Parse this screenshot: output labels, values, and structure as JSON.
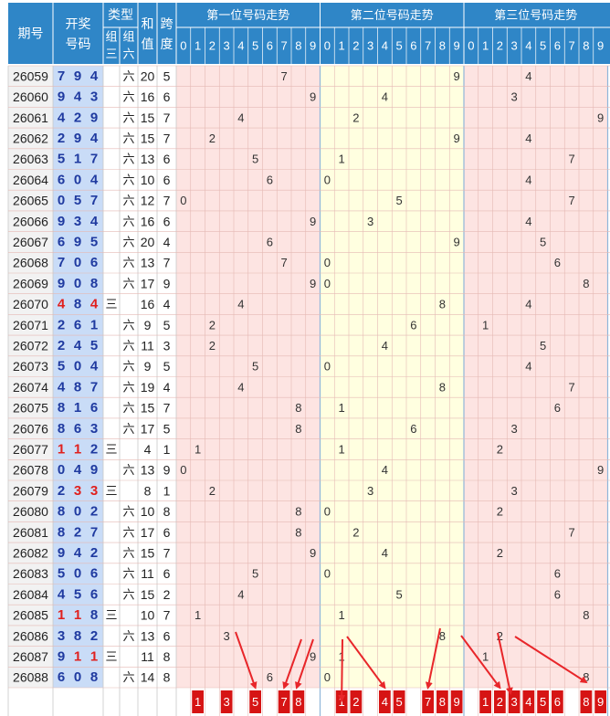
{
  "header": {
    "period_label": "期号",
    "lottery_label_line1": "开奖",
    "lottery_label_line2": "号码",
    "type_label": "类型",
    "zu3_label_line1": "组",
    "zu3_label_line2": "三",
    "zu6_label_line1": "组",
    "zu6_label_line2": "六",
    "sum_label_line1": "和",
    "sum_label_line2": "值",
    "span_label_line1": "跨",
    "span_label_line2": "度",
    "pos1_title": "第一位号码走势",
    "pos2_title": "第二位号码走势",
    "pos3_title": "第三位号码走势",
    "digits": [
      "0",
      "1",
      "2",
      "3",
      "4",
      "5",
      "6",
      "7",
      "8",
      "9"
    ]
  },
  "markers": {
    "zu3": "三",
    "zu6": "六"
  },
  "colors": {
    "header_blue": "#2f86c7",
    "period_bg": "#f2f2f2",
    "number_col_bg": "#c9dcf7",
    "number_blue": "#1f3aa0",
    "number_red": "#e0201e",
    "pos1_bg": "#fde4e2",
    "pos2_bg": "#ffffe0",
    "pos3_bg": "#fde4e2",
    "grid_line": "#e5b9b4",
    "prediction_box": "#d61414",
    "arrow": "#e8262a"
  },
  "chart_data": {
    "type": "table",
    "columns": [
      "期号",
      "开奖号码",
      "组三",
      "组六",
      "和值",
      "跨度",
      "第一位",
      "第二位",
      "第三位"
    ],
    "rows": [
      {
        "period": "26059",
        "digits": [
          7,
          9,
          4
        ],
        "type": "六",
        "sum": 20,
        "span": 5
      },
      {
        "period": "26060",
        "digits": [
          9,
          4,
          3
        ],
        "type": "六",
        "sum": 16,
        "span": 6
      },
      {
        "period": "26061",
        "digits": [
          4,
          2,
          9
        ],
        "type": "六",
        "sum": 15,
        "span": 7
      },
      {
        "period": "26062",
        "digits": [
          2,
          9,
          4
        ],
        "type": "六",
        "sum": 15,
        "span": 7
      },
      {
        "period": "26063",
        "digits": [
          5,
          1,
          7
        ],
        "type": "六",
        "sum": 13,
        "span": 6
      },
      {
        "period": "26064",
        "digits": [
          6,
          0,
          4
        ],
        "type": "六",
        "sum": 10,
        "span": 6
      },
      {
        "period": "26065",
        "digits": [
          0,
          5,
          7
        ],
        "type": "六",
        "sum": 12,
        "span": 7
      },
      {
        "period": "26066",
        "digits": [
          9,
          3,
          4
        ],
        "type": "六",
        "sum": 16,
        "span": 6
      },
      {
        "period": "26067",
        "digits": [
          6,
          9,
          5
        ],
        "type": "六",
        "sum": 20,
        "span": 4
      },
      {
        "period": "26068",
        "digits": [
          7,
          0,
          6
        ],
        "type": "六",
        "sum": 13,
        "span": 7
      },
      {
        "period": "26069",
        "digits": [
          9,
          0,
          8
        ],
        "type": "六",
        "sum": 17,
        "span": 9
      },
      {
        "period": "26070",
        "digits": [
          4,
          8,
          4
        ],
        "type": "三",
        "sum": 16,
        "span": 4
      },
      {
        "period": "26071",
        "digits": [
          2,
          6,
          1
        ],
        "type": "六",
        "sum": 9,
        "span": 5
      },
      {
        "period": "26072",
        "digits": [
          2,
          4,
          5
        ],
        "type": "六",
        "sum": 11,
        "span": 3
      },
      {
        "period": "26073",
        "digits": [
          5,
          0,
          4
        ],
        "type": "六",
        "sum": 9,
        "span": 5
      },
      {
        "period": "26074",
        "digits": [
          4,
          8,
          7
        ],
        "type": "六",
        "sum": 19,
        "span": 4
      },
      {
        "period": "26075",
        "digits": [
          8,
          1,
          6
        ],
        "type": "六",
        "sum": 15,
        "span": 7
      },
      {
        "period": "26076",
        "digits": [
          8,
          6,
          3
        ],
        "type": "六",
        "sum": 17,
        "span": 5
      },
      {
        "period": "26077",
        "digits": [
          1,
          1,
          2
        ],
        "type": "三",
        "sum": 4,
        "span": 1
      },
      {
        "period": "26078",
        "digits": [
          0,
          4,
          9
        ],
        "type": "六",
        "sum": 13,
        "span": 9
      },
      {
        "period": "26079",
        "digits": [
          2,
          3,
          3
        ],
        "type": "三",
        "sum": 8,
        "span": 1
      },
      {
        "period": "26080",
        "digits": [
          8,
          0,
          2
        ],
        "type": "六",
        "sum": 10,
        "span": 8
      },
      {
        "period": "26081",
        "digits": [
          8,
          2,
          7
        ],
        "type": "六",
        "sum": 17,
        "span": 6
      },
      {
        "period": "26082",
        "digits": [
          9,
          4,
          2
        ],
        "type": "六",
        "sum": 15,
        "span": 7
      },
      {
        "period": "26083",
        "digits": [
          5,
          0,
          6
        ],
        "type": "六",
        "sum": 11,
        "span": 6
      },
      {
        "period": "26084",
        "digits": [
          4,
          5,
          6
        ],
        "type": "六",
        "sum": 15,
        "span": 2
      },
      {
        "period": "26085",
        "digits": [
          1,
          1,
          8
        ],
        "type": "三",
        "sum": 10,
        "span": 7
      },
      {
        "period": "26086",
        "digits": [
          3,
          8,
          2
        ],
        "type": "六",
        "sum": 13,
        "span": 6
      },
      {
        "period": "26087",
        "digits": [
          9,
          1,
          1
        ],
        "type": "三",
        "sum": 11,
        "span": 8
      },
      {
        "period": "26088",
        "digits": [
          6,
          0,
          8
        ],
        "type": "六",
        "sum": 14,
        "span": 8
      }
    ],
    "prediction_row": {
      "pos1": [
        1,
        3,
        5,
        7,
        8
      ],
      "pos2": [
        1,
        2,
        4,
        5,
        7,
        8,
        9
      ],
      "pos3": [
        1,
        2,
        3,
        4,
        5,
        6,
        8,
        9
      ]
    }
  }
}
